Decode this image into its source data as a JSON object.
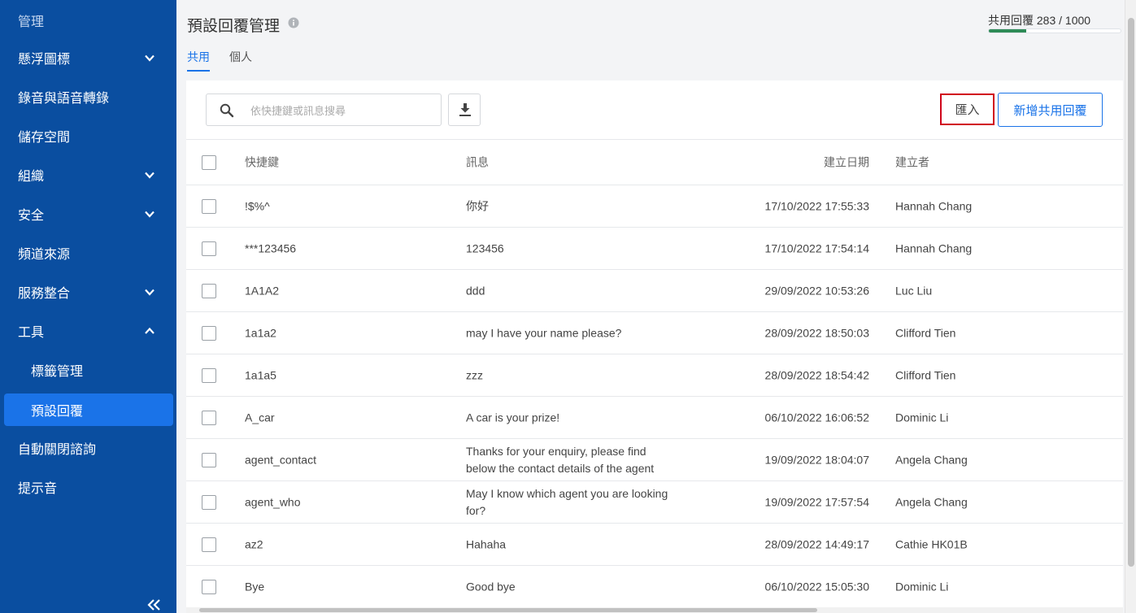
{
  "sidebar": {
    "section_title": "管理",
    "items": [
      {
        "label": "懸浮圖標",
        "chevron": "down"
      },
      {
        "label": "錄音與語音轉錄",
        "chevron": ""
      },
      {
        "label": "儲存空間",
        "chevron": ""
      },
      {
        "label": "組織",
        "chevron": "down"
      },
      {
        "label": "安全",
        "chevron": "down"
      },
      {
        "label": "頻道來源",
        "chevron": ""
      },
      {
        "label": "服務整合",
        "chevron": "down"
      },
      {
        "label": "工具",
        "chevron": "up"
      },
      {
        "label": "標籤管理",
        "chevron": "",
        "sub": true
      },
      {
        "label": "預設回覆",
        "chevron": "",
        "sub": true,
        "active": true
      },
      {
        "label": "自動關閉諮詢",
        "chevron": ""
      },
      {
        "label": "提示音",
        "chevron": ""
      }
    ],
    "collapse_icon": "double-chevron-left-icon"
  },
  "header": {
    "title": "預設回覆管理",
    "tabs": [
      {
        "label": "共用",
        "active": true
      },
      {
        "label": "個人",
        "active": false
      }
    ],
    "usage_label": "共用回覆 283 / 1000",
    "usage_fraction": 0.283,
    "usage_color": "#2e8b57"
  },
  "toolbar": {
    "search_placeholder": "依快捷鍵或訊息搜尋",
    "import_label": "匯入",
    "add_label": "新增共用回覆"
  },
  "table": {
    "columns": {
      "key": "快捷鍵",
      "message": "訊息",
      "date": "建立日期",
      "creator": "建立者"
    },
    "rows": [
      {
        "key": "!$%^",
        "message": "你好",
        "date": "17/10/2022 17:55:33",
        "creator": "Hannah Chang"
      },
      {
        "key": "***123456",
        "message": "123456",
        "date": "17/10/2022 17:54:14",
        "creator": "Hannah Chang"
      },
      {
        "key": "1A1A2",
        "message": "ddd",
        "date": "29/09/2022 10:53:26",
        "creator": "Luc Liu"
      },
      {
        "key": "1a1a2",
        "message": "may I have your name please?",
        "date": "28/09/2022 18:50:03",
        "creator": "Clifford Tien"
      },
      {
        "key": "1a1a5",
        "message": "zzz",
        "date": "28/09/2022 18:54:42",
        "creator": "Clifford Tien"
      },
      {
        "key": "A_car",
        "message": "A car is your prize!",
        "date": "06/10/2022 16:06:52",
        "creator": "Dominic Li"
      },
      {
        "key": "agent_contact",
        "message": "Thanks for your enquiry, please find below the contact details of the agent",
        "date": "19/09/2022 18:04:07",
        "creator": "Angela Chang"
      },
      {
        "key": "agent_who",
        "message": "May I know which agent you are looking for?",
        "date": "19/09/2022 17:57:54",
        "creator": "Angela Chang"
      },
      {
        "key": "az2",
        "message": "Hahaha",
        "date": "28/09/2022 14:49:17",
        "creator": "Cathie HK01B"
      },
      {
        "key": "Bye",
        "message": "Good bye",
        "date": "06/10/2022 15:05:30",
        "creator": "Dominic Li"
      }
    ]
  },
  "colors": {
    "sidebar_bg": "#0a4ea0",
    "active_bg": "#1a73e8",
    "accent": "#1a73e8",
    "highlight_border": "#d0021b"
  }
}
